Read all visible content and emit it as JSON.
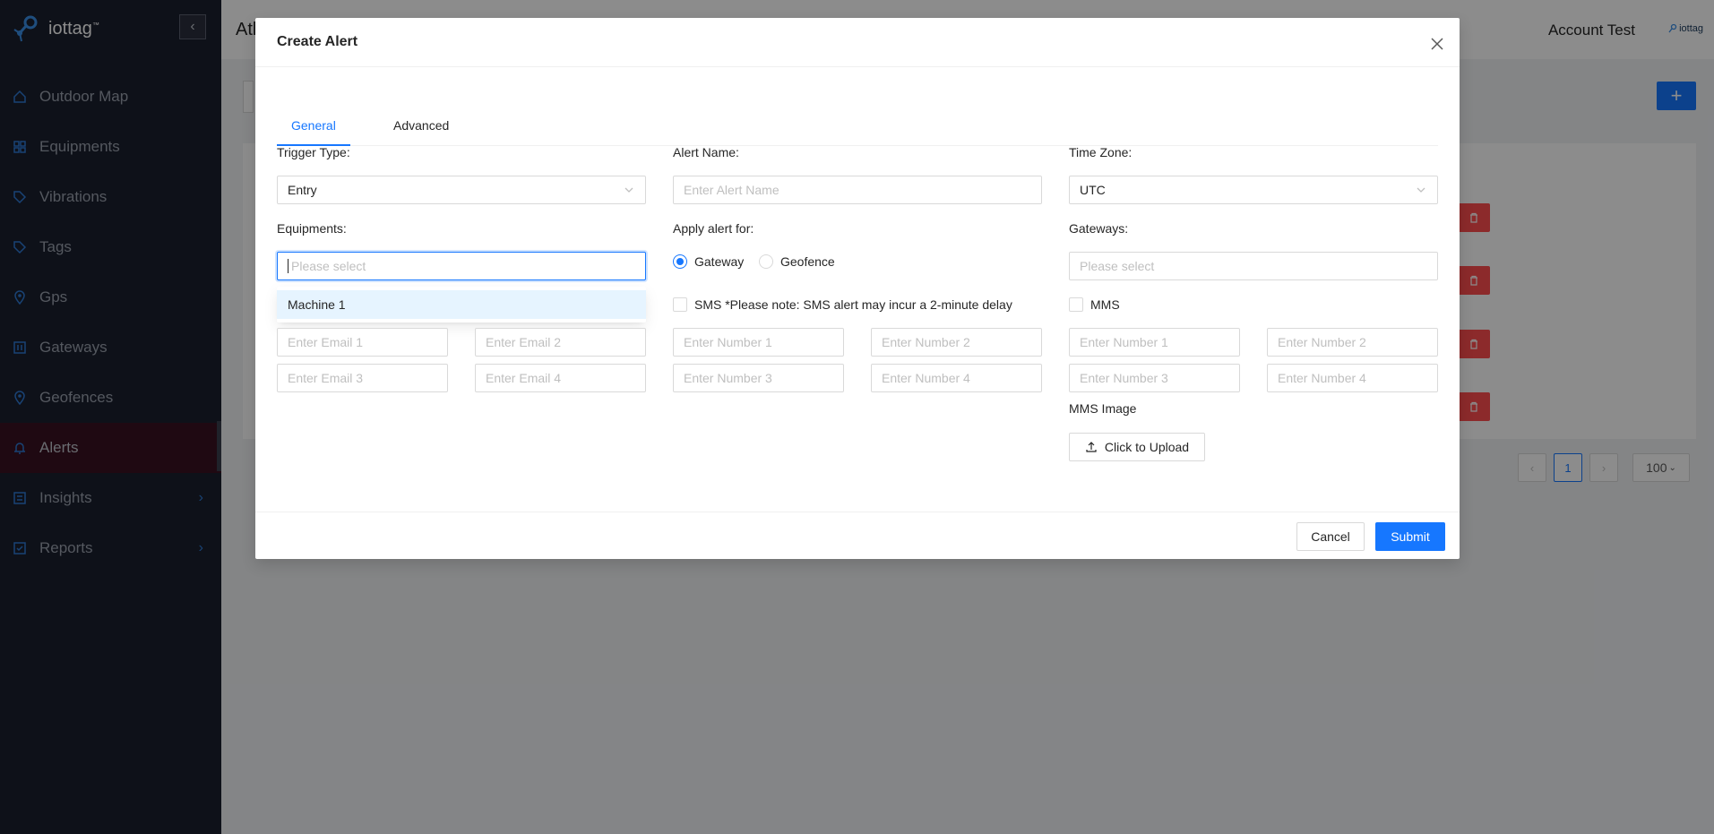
{
  "app": {
    "logo_text": "iottag",
    "logo_tm": "™"
  },
  "sidebar": {
    "items": [
      {
        "label": "Outdoor Map",
        "icon": "home-icon"
      },
      {
        "label": "Equipments",
        "icon": "grid-icon"
      },
      {
        "label": "Vibrations",
        "icon": "tag-icon"
      },
      {
        "label": "Tags",
        "icon": "tag-icon"
      },
      {
        "label": "Gps",
        "icon": "location-icon"
      },
      {
        "label": "Gateways",
        "icon": "gateway-icon"
      },
      {
        "label": "Geofences",
        "icon": "location-icon"
      },
      {
        "label": "Alerts",
        "icon": "bell-icon"
      },
      {
        "label": "Insights",
        "icon": "chart-icon"
      },
      {
        "label": "Reports",
        "icon": "report-icon"
      }
    ],
    "active": "Alerts"
  },
  "header": {
    "title_partial": "Atl",
    "account": "Account Test",
    "mini_logo": "iottag"
  },
  "background": {
    "pagination_current": "1",
    "page_size": "100"
  },
  "modal": {
    "title": "Create Alert",
    "tabs": {
      "general": "General",
      "advanced": "Advanced"
    },
    "trigger_type": {
      "label": "Trigger Type:",
      "value": "Entry"
    },
    "alert_name": {
      "label": "Alert Name:",
      "placeholder": "Enter Alert Name"
    },
    "time_zone": {
      "label": "Time Zone:",
      "value": "UTC"
    },
    "equipments": {
      "label": "Equipments:",
      "placeholder": "Please select",
      "options": [
        "Machine 1"
      ]
    },
    "apply_for": {
      "label": "Apply alert for:",
      "options": [
        "Gateway",
        "Geofence"
      ],
      "selected": "Gateway"
    },
    "gateways": {
      "label": "Gateways:",
      "placeholder": "Please select"
    },
    "email": {
      "placeholders": [
        "Enter Email 1",
        "Enter Email 2",
        "Enter Email 3",
        "Enter Email 4"
      ]
    },
    "sms": {
      "label": "SMS *Please note: SMS alert may incur a 2-minute delay",
      "placeholders": [
        "Enter Number 1",
        "Enter Number 2",
        "Enter Number 3",
        "Enter Number 4"
      ]
    },
    "mms": {
      "label": "MMS",
      "placeholders": [
        "Enter Number 1",
        "Enter Number 2",
        "Enter Number 3",
        "Enter Number 4"
      ],
      "image_label": "MMS Image",
      "upload_label": "Click to Upload"
    },
    "footer": {
      "cancel": "Cancel",
      "submit": "Submit"
    }
  },
  "colors": {
    "primary": "#1677ff",
    "sidebar_bg": "#1a1f2e",
    "danger": "#ff4d4f",
    "active_item_bg": "#3a1221"
  }
}
